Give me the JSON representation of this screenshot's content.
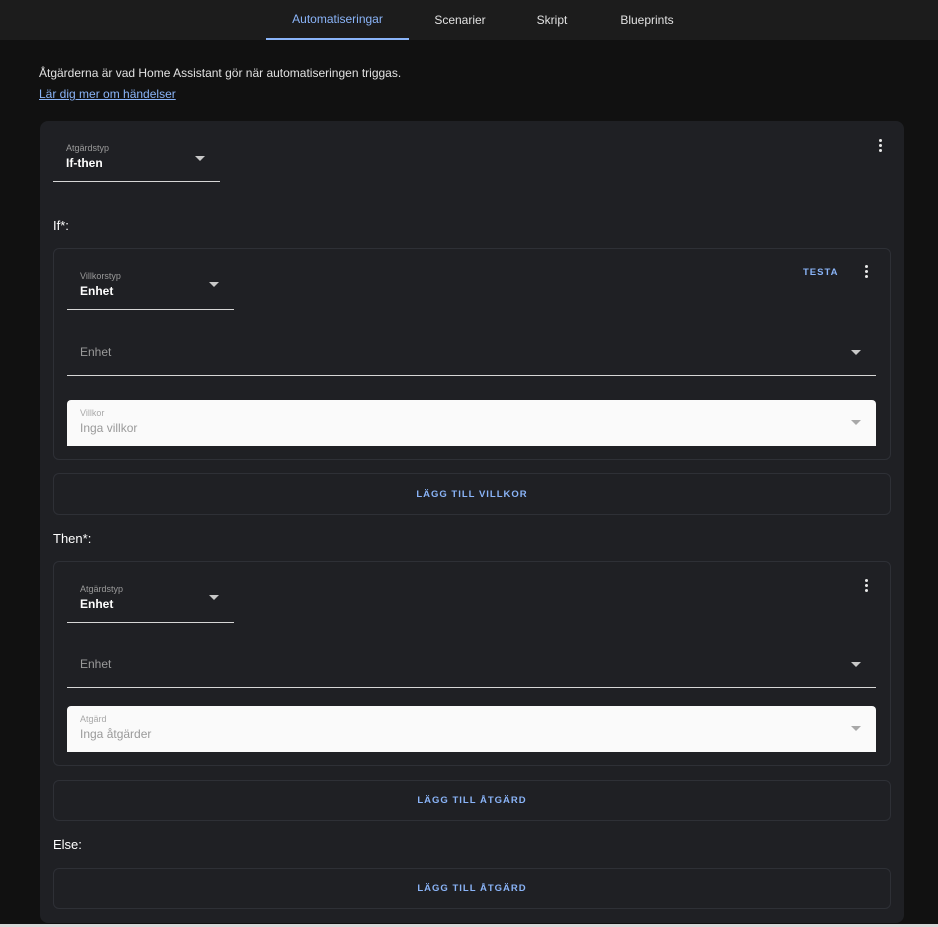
{
  "tabs": [
    {
      "label": "Automatiseringar",
      "active": true
    },
    {
      "label": "Scenarier"
    },
    {
      "label": "Skript"
    },
    {
      "label": "Blueprints"
    }
  ],
  "intro": {
    "text": "Åtgärderna är vad Home Assistant gör när automatiseringen triggas.",
    "link": "Lär dig mer om händelser"
  },
  "action": {
    "type_label": "Atgärdstyp",
    "type_value": "If-then",
    "if_label": "If*:",
    "then_label": "Then*:",
    "else_label": "Else:",
    "condition": {
      "type_label": "Villkorstyp",
      "type_value": "Enhet",
      "test_button": "TESTA",
      "device_placeholder": "Enhet",
      "condition_label": "Villkor",
      "condition_placeholder": "Inga villkor"
    },
    "add_condition": "LÄGG TILL VILLKOR",
    "then_action": {
      "type_label": "Atgärdstyp",
      "type_value": "Enhet",
      "device_placeholder": "Enhet",
      "action_label": "Atgärd",
      "action_placeholder": "Inga åtgärder"
    },
    "add_action_then": "LÄGG TILL ÅTGÄRD",
    "add_action_else": "LÄGG TILL ÅTGÄRD"
  },
  "colors": {
    "accent": "#8ab4f8",
    "background": "#111111",
    "card": "#1f2024"
  }
}
